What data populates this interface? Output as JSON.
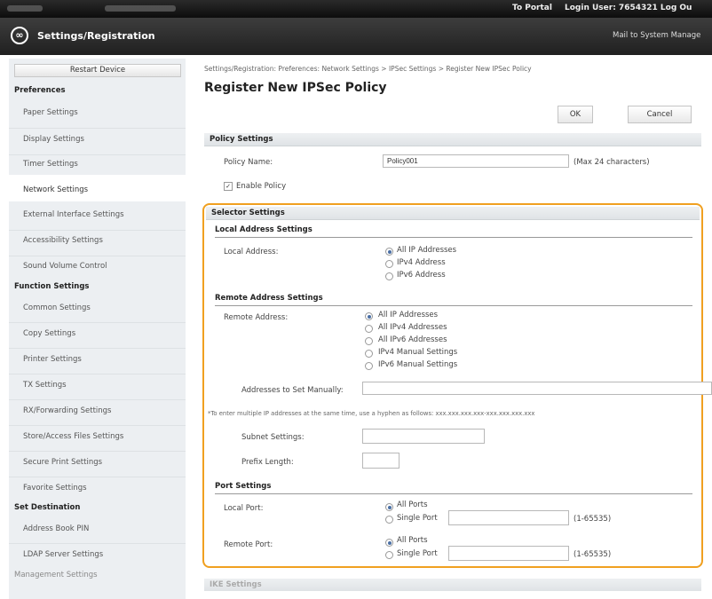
{
  "header": {
    "portal_link": "To Portal",
    "login_user": "Login User:  7654321  Log Ou",
    "app_title": "Settings/Registration",
    "mail_link": "Mail to System Manage"
  },
  "sidebar": {
    "restart_label": "Restart Device",
    "sections": [
      {
        "title": "Preferences",
        "items": [
          "Paper Settings",
          "Display Settings",
          "Timer Settings",
          "Network Settings",
          "External Interface Settings",
          "Accessibility Settings",
          "Sound Volume Control"
        ]
      },
      {
        "title": "Function Settings",
        "items": [
          "Common Settings",
          "Copy Settings",
          "Printer Settings",
          "TX Settings",
          "RX/Forwarding Settings",
          "Store/Access Files Settings",
          "Secure Print Settings",
          "Favorite Settings"
        ]
      },
      {
        "title": "Set Destination",
        "items": [
          "Address Book PIN",
          "LDAP Server Settings"
        ]
      },
      {
        "title": "Management Settings",
        "items": []
      }
    ],
    "selected": "Network Settings"
  },
  "main": {
    "breadcrumb": "Settings/Registration: Preferences: Network Settings > IPSec Settings > Register New IPSec Policy",
    "title": "Register New IPSec Policy",
    "ok_label": "OK",
    "cancel_label": "Cancel",
    "policy": {
      "header": "Policy Settings",
      "name_label": "Policy Name:",
      "name_value": "Policy001",
      "name_hint": "(Max 24 characters)",
      "enable_label": "Enable Policy",
      "enable_checked": true
    },
    "selector": {
      "header": "Selector Settings",
      "local": {
        "header": "Local Address Settings",
        "label": "Local Address:",
        "options": [
          "All IP Addresses",
          "IPv4 Address",
          "IPv6 Address"
        ],
        "selected": 0
      },
      "remote": {
        "header": "Remote Address Settings",
        "label": "Remote Address:",
        "options": [
          "All IP Addresses",
          "All IPv4 Addresses",
          "All IPv6 Addresses",
          "IPv4 Manual Settings",
          "IPv6 Manual Settings"
        ],
        "selected": 0,
        "manual_label": "Addresses to Set Manually:",
        "note": "*To enter multiple IP addresses at the same time, use a hyphen as follows: xxx.xxx.xxx.xxx-xxx.xxx.xxx.xxx",
        "subnet_label": "Subnet Settings:",
        "prefix_label": "Prefix Length:"
      },
      "port": {
        "header": "Port Settings",
        "local_label": "Local Port:",
        "remote_label": "Remote Port:",
        "all_ports": "All Ports",
        "single_port": "Single Port",
        "range": "(1-65535)"
      }
    },
    "ike_header": "IKE Settings"
  }
}
